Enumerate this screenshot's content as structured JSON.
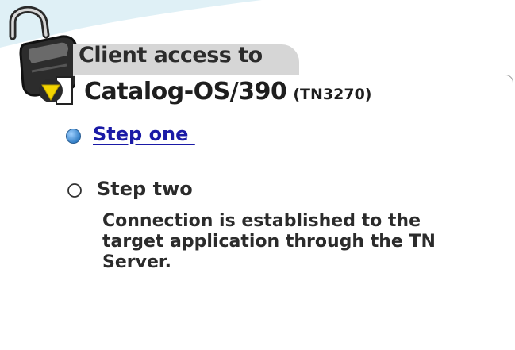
{
  "header": {
    "title_prefix": "Client access to",
    "app_name": "Catalog-OS/390",
    "protocol": "(TN3270)"
  },
  "icons": {
    "lock": "open-padlock-icon",
    "status": "yellow-warning-triangle-icon",
    "step_active": "blue-filled-circle-icon",
    "step_inactive": "empty-circle-icon"
  },
  "steps": [
    {
      "label": "Step one ",
      "state": "active-link"
    },
    {
      "label": "Step two",
      "state": "current",
      "description_lines": [
        "Connection is established to the",
        "target application through the TN",
        "Server."
      ]
    }
  ],
  "colors": {
    "link": "#1a1aa6",
    "tab_background": "#d6d6d6",
    "text": "#2b2b2b",
    "status_yellow": "#f3d400",
    "step_active_blue": "#3d8fd6"
  }
}
